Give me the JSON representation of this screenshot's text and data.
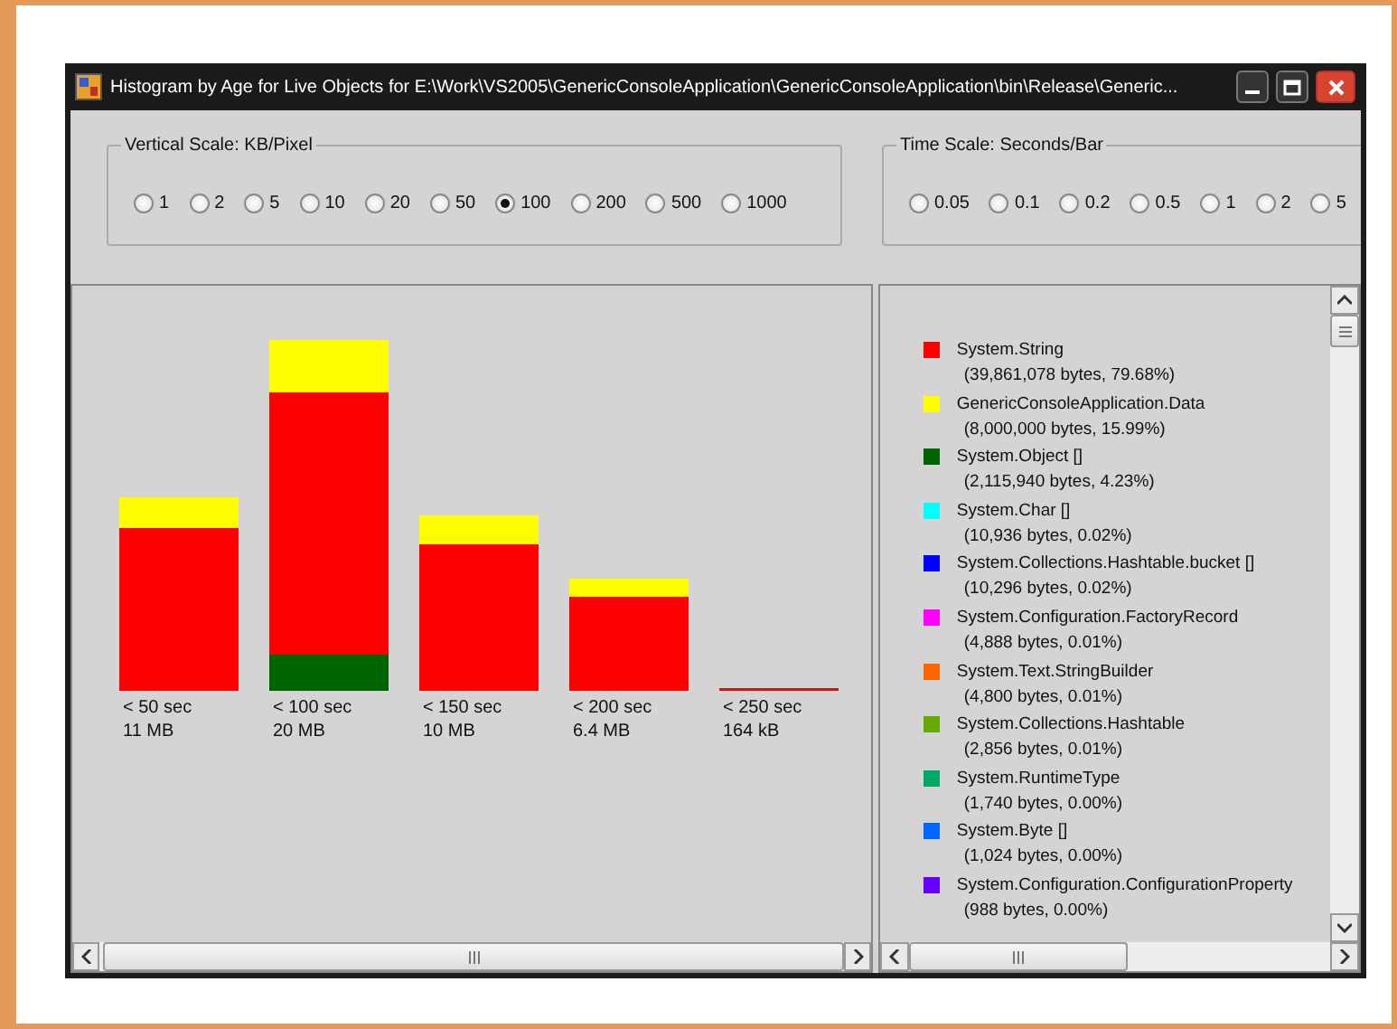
{
  "window": {
    "title": "Histogram by Age for Live Objects for E:\\Work\\VS2005\\GenericConsoleApplication\\GenericConsoleApplication\\bin\\Release\\Generic..."
  },
  "vertical_scale": {
    "title": "Vertical Scale: KB/Pixel",
    "options": [
      {
        "label": "1",
        "selected": false
      },
      {
        "label": "2",
        "selected": false
      },
      {
        "label": "5",
        "selected": false
      },
      {
        "label": "10",
        "selected": false
      },
      {
        "label": "20",
        "selected": false
      },
      {
        "label": "50",
        "selected": false
      },
      {
        "label": "100",
        "selected": true
      },
      {
        "label": "200",
        "selected": false
      },
      {
        "label": "500",
        "selected": false
      },
      {
        "label": "1000",
        "selected": false
      }
    ]
  },
  "time_scale": {
    "title": "Time Scale: Seconds/Bar",
    "options": [
      {
        "label": "0.05",
        "selected": false
      },
      {
        "label": "0.1",
        "selected": false
      },
      {
        "label": "0.2",
        "selected": false
      },
      {
        "label": "0.5",
        "selected": false
      },
      {
        "label": "1",
        "selected": false
      },
      {
        "label": "2",
        "selected": false
      },
      {
        "label": "5",
        "selected": false
      }
    ]
  },
  "histogram": [
    {
      "label": "< 50 sec",
      "size": "11 MB",
      "segments": [
        {
          "color": "#ff0000"
        },
        {
          "color": "#ffff00"
        }
      ]
    },
    {
      "label": "< 100 sec",
      "size": "20 MB",
      "segments": [
        {
          "color": "#006400"
        },
        {
          "color": "#ff0000"
        },
        {
          "color": "#ffff00"
        }
      ]
    },
    {
      "label": "< 150 sec",
      "size": "10 MB",
      "segments": [
        {
          "color": "#ff0000"
        },
        {
          "color": "#ffff00"
        }
      ]
    },
    {
      "label": "< 200 sec",
      "size": "6.4 MB",
      "segments": [
        {
          "color": "#ff0000"
        },
        {
          "color": "#ffff00"
        }
      ]
    },
    {
      "label": "< 250 sec",
      "size": "164 kB",
      "segments": [
        {
          "color": "#ff0000"
        }
      ]
    }
  ],
  "legend": [
    {
      "name": "System.String",
      "detail": "(39,861,078 bytes, 79.68%)",
      "color": "#ff0000"
    },
    {
      "name": "GenericConsoleApplication.Data",
      "detail": "(8,000,000 bytes, 15.99%)",
      "color": "#ffff00"
    },
    {
      "name": "System.Object []",
      "detail": "(2,115,940 bytes, 4.23%)",
      "color": "#006400"
    },
    {
      "name": "System.Char []",
      "detail": "(10,936 bytes, 0.02%)",
      "color": "#00ffff"
    },
    {
      "name": "System.Collections.Hashtable.bucket []",
      "detail": "(10,296 bytes, 0.02%)",
      "color": "#0000ff"
    },
    {
      "name": "System.Configuration.FactoryRecord",
      "detail": "(4,888 bytes, 0.01%)",
      "color": "#ff00ff"
    },
    {
      "name": "System.Text.StringBuilder",
      "detail": "(4,800 bytes, 0.01%)",
      "color": "#ff6600"
    },
    {
      "name": "System.Collections.Hashtable",
      "detail": "(2,856 bytes, 0.01%)",
      "color": "#66aa00"
    },
    {
      "name": "System.RuntimeType",
      "detail": "(1,740 bytes, 0.00%)",
      "color": "#00aa66"
    },
    {
      "name": "System.Byte []",
      "detail": "(1,024 bytes, 0.00%)",
      "color": "#0066ff"
    },
    {
      "name": "System.Configuration.ConfigurationProperty",
      "detail": "(988 bytes, 0.00%)",
      "color": "#6600ff"
    }
  ]
}
